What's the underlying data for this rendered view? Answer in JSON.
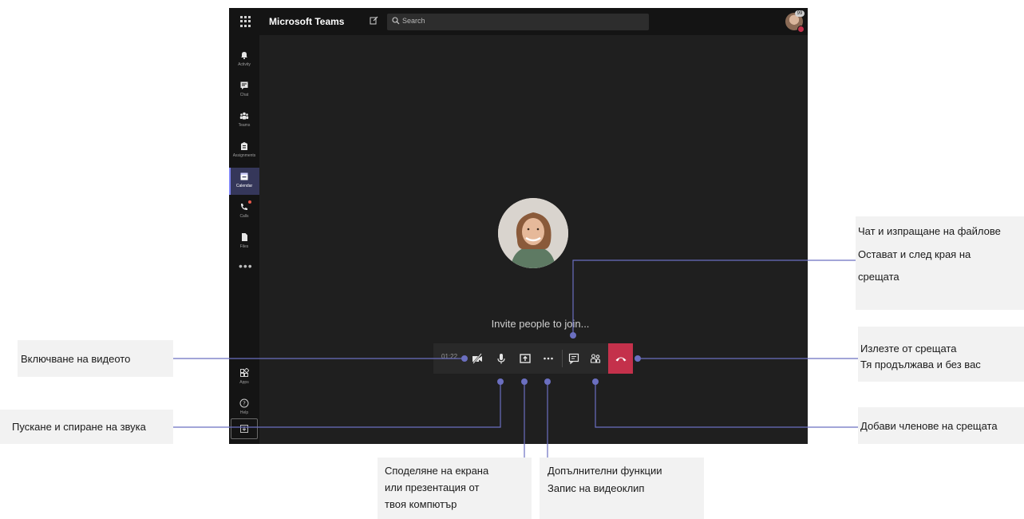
{
  "app": {
    "title": "Microsoft Teams",
    "search_placeholder": "Search",
    "notification_count": "99"
  },
  "rail": {
    "items": [
      {
        "label": "Activity",
        "icon": "bell-icon"
      },
      {
        "label": "Chat",
        "icon": "chat-icon"
      },
      {
        "label": "Teams",
        "icon": "teams-icon"
      },
      {
        "label": "Assignments",
        "icon": "assignments-icon"
      },
      {
        "label": "Calendar",
        "icon": "calendar-icon",
        "active": true
      },
      {
        "label": "Calls",
        "icon": "phone-icon",
        "badge": true
      },
      {
        "label": "Files",
        "icon": "files-icon"
      }
    ],
    "more": "•••",
    "bottom": [
      {
        "label": "Apps",
        "icon": "apps-icon"
      },
      {
        "label": "Help",
        "icon": "help-icon"
      }
    ]
  },
  "call": {
    "invite_text": "Invite people to join...",
    "timer": "01:22",
    "more_glyph": "•••"
  },
  "callouts": {
    "video": "Включване на видеото",
    "audio": "Пускане и спиране на звука",
    "share": [
      "Споделяне на екрана",
      "или презентация от",
      "твоя компютър"
    ],
    "more": [
      "Допълнителни функции",
      "Запис на видеоклип"
    ],
    "chat": [
      "Чат и изпращане на файлове",
      "Остават и след края на",
      "срещата"
    ],
    "leave": [
      "Излезте от срещата",
      "Тя продължава и без вас"
    ],
    "add": "Добави членове на срещата"
  },
  "colors": {
    "accent": "#7f85f5",
    "hangup": "#c4314b",
    "dots": "#6b6fc0",
    "background": "#1f1f1f"
  }
}
